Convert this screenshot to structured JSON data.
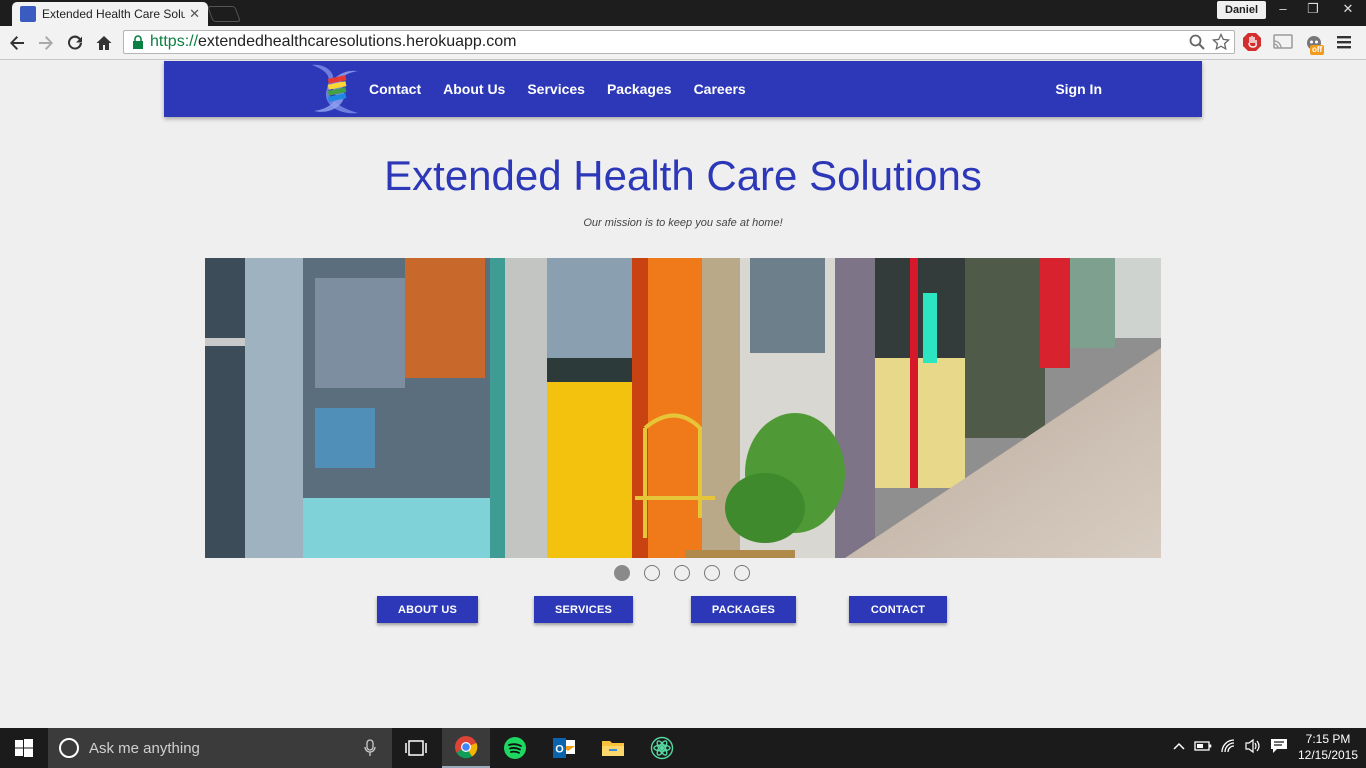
{
  "browser": {
    "tab_title": "Extended Health Care Solu",
    "profile_name": "Daniel",
    "window_controls": [
      "–",
      "❐",
      "✕"
    ],
    "url_scheme": "https://",
    "url_rest": "extendedhealthcaresolutions.herokuapp.com",
    "extension_badge": "off",
    "icons": [
      "back-icon",
      "forward-icon",
      "reload-icon",
      "home-icon",
      "lock-icon",
      "zoom-icon",
      "star-icon",
      "extension-icon",
      "cast-icon",
      "menu-icon"
    ]
  },
  "site": {
    "nav_links": [
      "Contact",
      "About Us",
      "Services",
      "Packages",
      "Careers"
    ],
    "sign_in": "Sign In",
    "title": "Extended Health Care Solutions",
    "mission": "Our mission is to keep you safe at home!",
    "carousel": {
      "slide_count": 5,
      "active_index": 0
    },
    "cta_buttons": [
      "ABOUT US",
      "SERVICES",
      "PACKAGES",
      "CONTACT"
    ],
    "colors": {
      "brand": "#2c38b7",
      "background": "#efefef"
    }
  },
  "taskbar": {
    "search_placeholder": "Ask me anything",
    "time": "7:15 PM",
    "date": "12/15/2015",
    "apps": [
      "chrome-icon",
      "spotify-icon",
      "outlook-icon",
      "file-explorer-icon",
      "atom-icon"
    ]
  }
}
